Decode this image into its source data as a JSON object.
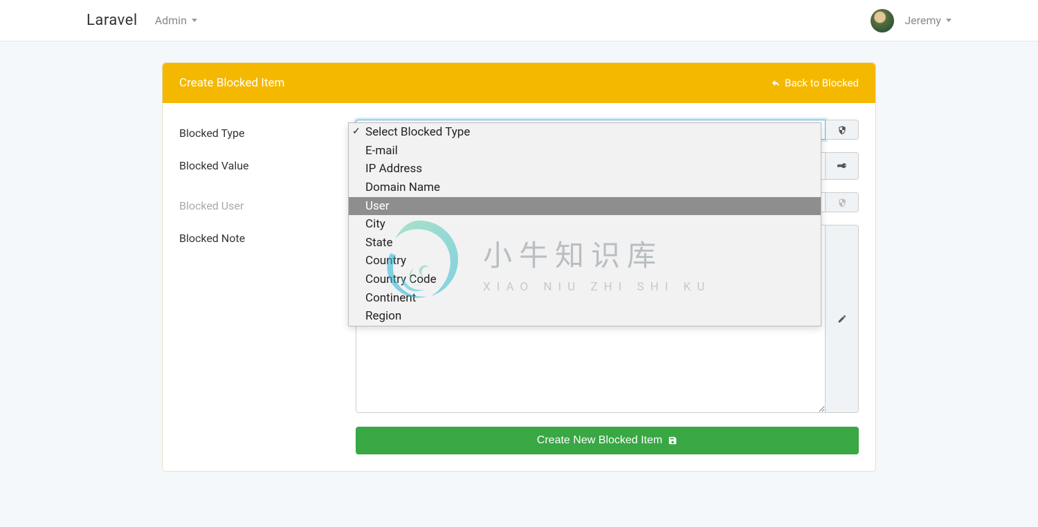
{
  "navbar": {
    "brand": "Laravel",
    "admin_label": "Admin",
    "user_name": "Jeremy"
  },
  "card": {
    "title": "Create Blocked Item",
    "back_label": "Back to Blocked"
  },
  "form": {
    "blocked_type_label": "Blocked Type",
    "blocked_value_label": "Blocked Value",
    "blocked_user_label": "Blocked User",
    "blocked_note_label": "Blocked Note"
  },
  "dropdown": {
    "options": [
      "Select Blocked Type",
      "E-mail",
      "IP Address",
      "Domain Name",
      "User",
      "City",
      "State",
      "Country",
      "Country Code",
      "Continent",
      "Region"
    ],
    "highlighted_index": 4
  },
  "submit_label": "Create New Blocked Item",
  "watermark": {
    "cn": "小牛知识库",
    "en": "XIAO NIU ZHI SHI KU"
  }
}
